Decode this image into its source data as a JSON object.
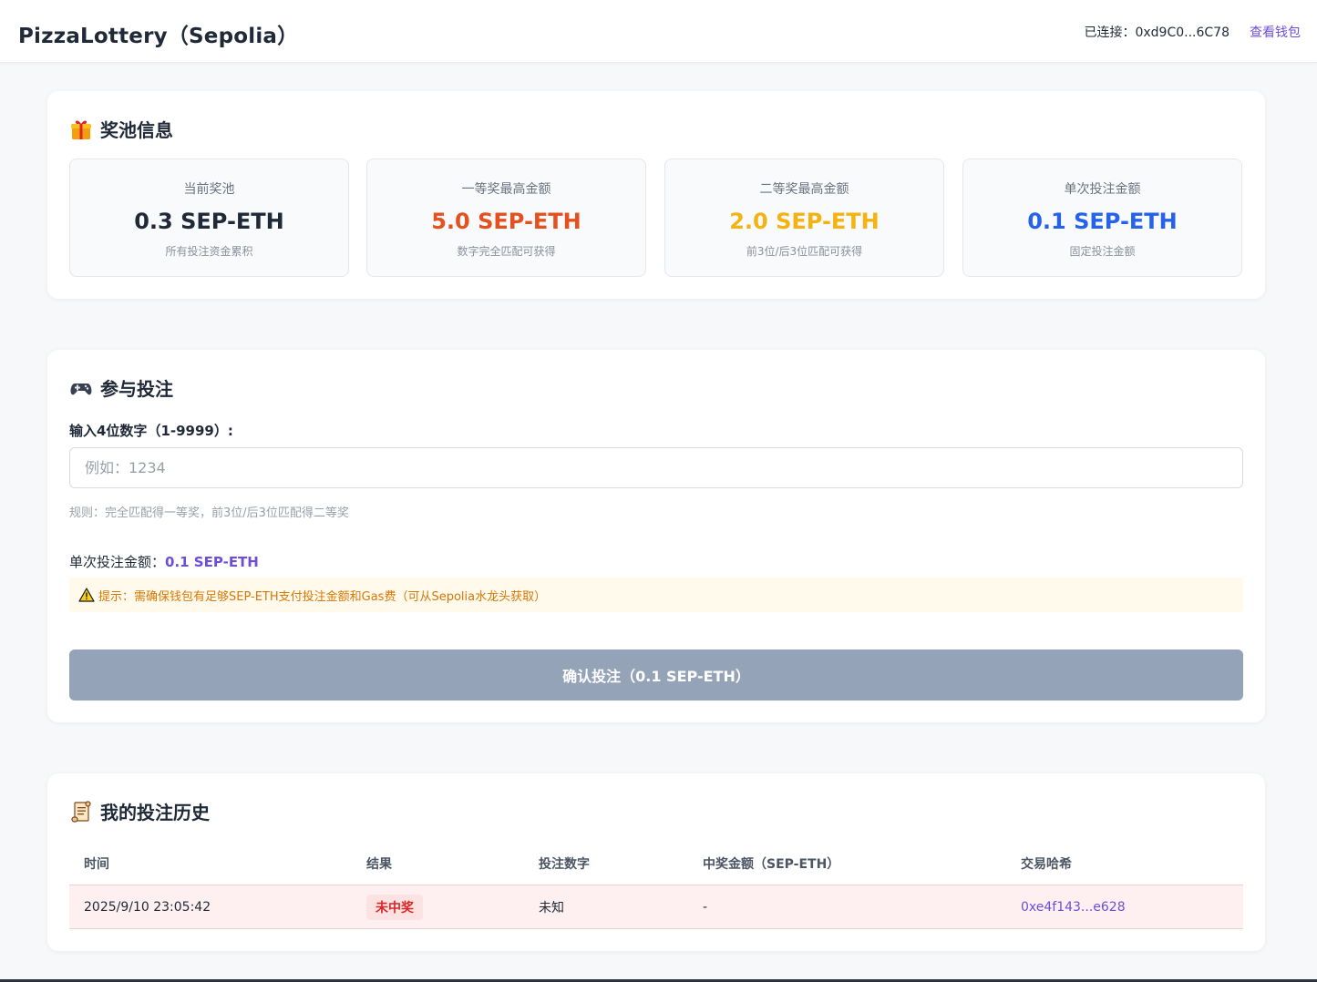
{
  "header": {
    "title": "PizzaLottery（Sepolia）",
    "connected_label": "已连接：0xd9C0...6C78",
    "wallet_link": "查看钱包"
  },
  "pool": {
    "title": "奖池信息",
    "icon": "gift-icon",
    "stats": [
      {
        "label": "当前奖池",
        "value": "0.3 SEP-ETH",
        "sub": "所有投注资金累积",
        "color": "#1f2937"
      },
      {
        "label": "一等奖最高金额",
        "value": "5.0 SEP-ETH",
        "sub": "数字完全匹配可获得",
        "color": "#e4511e"
      },
      {
        "label": "二等奖最高金额",
        "value": "2.0 SEP-ETH",
        "sub": "前3位/后3位匹配可获得",
        "color": "#f5b312"
      },
      {
        "label": "单次投注金额",
        "value": "0.1 SEP-ETH",
        "sub": "固定投注金额",
        "color": "#2563eb"
      }
    ]
  },
  "bet": {
    "title": "参与投注",
    "icon": "gamepad-icon",
    "input_label": "输入4位数字（1-9999）:",
    "input_placeholder": "例如：1234",
    "input_value": "",
    "rule": "规则：完全匹配得一等奖，前3位/后3位匹配得二等奖",
    "amount_label": "单次投注金额：",
    "amount_value": "0.1 SEP-ETH",
    "tip": "提示：需确保钱包有足够SEP-ETH支付投注金额和Gas费（可从Sepolia水龙头获取）",
    "submit_label": "确认投注（0.1 SEP-ETH）"
  },
  "history": {
    "title": "我的投注历史",
    "icon": "scroll-icon",
    "columns": [
      "时间",
      "结果",
      "投注数字",
      "中奖金额（SEP-ETH）",
      "交易哈希"
    ],
    "rows": [
      {
        "time": "2025/9/10 23:05:42",
        "result": "未中奖",
        "number": "未知",
        "prize": "-",
        "hash": "0xe4f143...e628"
      }
    ]
  }
}
